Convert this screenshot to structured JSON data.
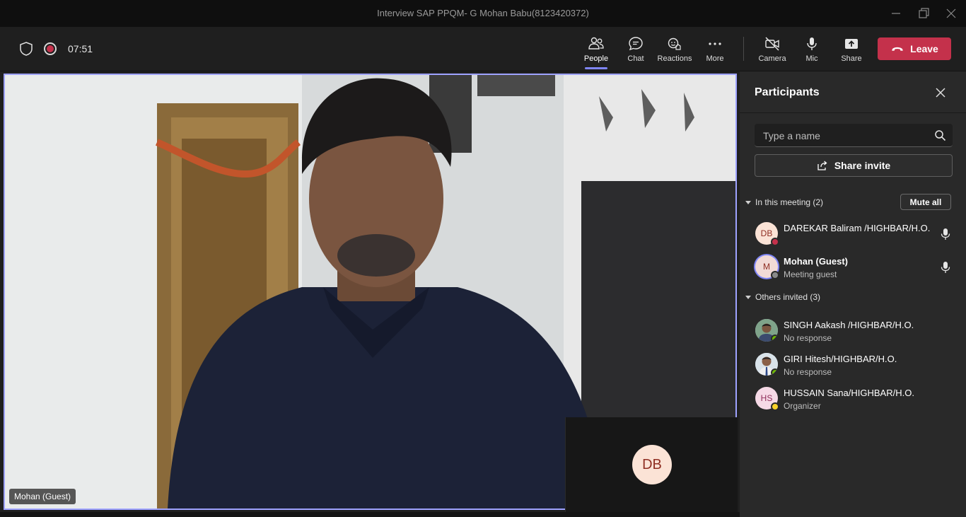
{
  "window": {
    "title": "Interview SAP PPQM- G Mohan Babu(8123420372)"
  },
  "toolbar": {
    "timer": "07:51",
    "buttons": [
      {
        "label": "People",
        "icon": "people-icon",
        "active": true
      },
      {
        "label": "Chat",
        "icon": "chat-icon"
      },
      {
        "label": "Reactions",
        "icon": "reactions-icon"
      },
      {
        "label": "More",
        "icon": "more-icon"
      },
      {
        "label": "Camera",
        "icon": "camera-off-icon"
      },
      {
        "label": "Mic",
        "icon": "mic-icon"
      },
      {
        "label": "Share",
        "icon": "share-icon"
      }
    ],
    "leave_label": "Leave",
    "colors": {
      "accent": "#7f85f5",
      "leave": "#c4314b"
    }
  },
  "stage": {
    "main_name": "Mohan (Guest)",
    "self_initials": "DB"
  },
  "panel": {
    "title": "Participants",
    "search_placeholder": "Type a name",
    "share_invite_label": "Share invite",
    "in_meeting_label": "In this meeting (2)",
    "mute_all_label": "Mute all",
    "others_label": "Others invited (3)",
    "in_meeting": [
      {
        "initials": "DB",
        "name": "DAREKAR Baliram /HIGHBAR/H.O.",
        "sub": "",
        "status": "busy",
        "mic": true
      },
      {
        "initials": "M",
        "name": "Mohan (Guest)",
        "sub": "Meeting guest",
        "status": "offline",
        "mic": true
      }
    ],
    "others": [
      {
        "initials": "",
        "name": "SINGH Aakash /HIGHBAR/H.O.",
        "sub": "No response",
        "status": "available"
      },
      {
        "initials": "",
        "name": "GIRI Hitesh/HIGHBAR/H.O.",
        "sub": "No response",
        "status": "available"
      },
      {
        "initials": "HS",
        "name": "HUSSAIN Sana/HIGHBAR/H.O.",
        "sub": "Organizer",
        "status": "away"
      }
    ]
  }
}
